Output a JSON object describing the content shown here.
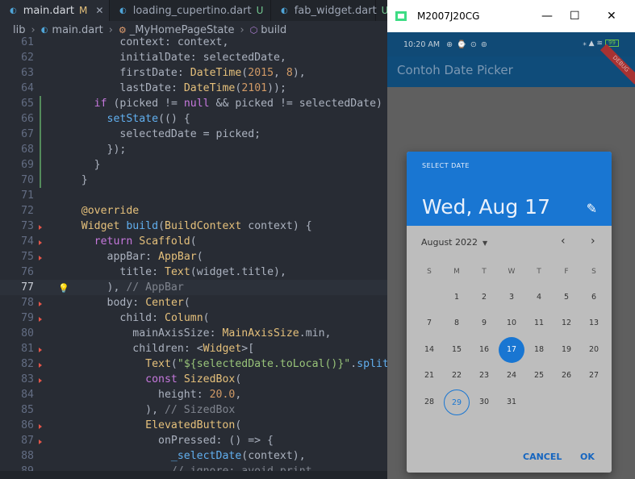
{
  "editor": {
    "tabs": [
      {
        "label": "main.dart",
        "mod": "M",
        "active": true
      },
      {
        "label": "loading_cupertino.dart",
        "mod": "U",
        "active": false
      },
      {
        "label": "fab_widget.dart",
        "mod": "U",
        "active": false
      }
    ],
    "breadcrumb": {
      "folder": "lib",
      "file": "main.dart",
      "cls": "_MyHomePageState",
      "method": "build"
    }
  },
  "code_lines": [
    {
      "n": "61",
      "t": "          context: context,"
    },
    {
      "n": "62",
      "t": "          initialDate: selectedDate,"
    },
    {
      "n": "63",
      "t": "          firstDate: DateTime(2015, 8),"
    },
    {
      "n": "64",
      "t": "          lastDate: DateTime(2101));"
    },
    {
      "n": "65",
      "t": "      if (picked != null && picked != selectedDate) {"
    },
    {
      "n": "66",
      "t": "        setState(() {"
    },
    {
      "n": "67",
      "t": "          selectedDate = picked;"
    },
    {
      "n": "68",
      "t": "        });"
    },
    {
      "n": "69",
      "t": "      }"
    },
    {
      "n": "70",
      "t": "    }"
    },
    {
      "n": "71",
      "t": ""
    },
    {
      "n": "72",
      "t": "    @override"
    },
    {
      "n": "73",
      "t": "    Widget build(BuildContext context) {"
    },
    {
      "n": "74",
      "t": "      return Scaffold("
    },
    {
      "n": "75",
      "t": "        appBar: AppBar("
    },
    {
      "n": "76",
      "t": "          title: Text(widget.title),"
    },
    {
      "n": "77",
      "t": "        ), // AppBar"
    },
    {
      "n": "78",
      "t": "        body: Center("
    },
    {
      "n": "79",
      "t": "          child: Column("
    },
    {
      "n": "80",
      "t": "            mainAxisSize: MainAxisSize.min,"
    },
    {
      "n": "81",
      "t": "            children: <Widget>["
    },
    {
      "n": "82",
      "t": "              Text(\"${selectedDate.toLocal()}\".split('"
    },
    {
      "n": "83",
      "t": "              const SizedBox("
    },
    {
      "n": "84",
      "t": "                height: 20.0,"
    },
    {
      "n": "85",
      "t": "              ), // SizedBox"
    },
    {
      "n": "86",
      "t": "              ElevatedButton("
    },
    {
      "n": "87",
      "t": "                onPressed: () => {"
    },
    {
      "n": "88",
      "t": "                  _selectDate(context),"
    },
    {
      "n": "89",
      "t": "                  // ignore: avoid_print"
    }
  ],
  "emulator": {
    "window_title": "M2007J20CG",
    "min": "—",
    "max": "☐",
    "close": "✕",
    "status_time": "10:20 AM",
    "status_icons": "⊕ ⌚ ⊙ ⊚",
    "status_right": "⁎ ▲ ≋",
    "battery": "99",
    "appbar_title": "Contoh Date Picker",
    "debug_banner": "DEBUG"
  },
  "dialog": {
    "caption": "SELECT DATE",
    "date": "Wed, Aug 17",
    "edit_icon": "✎",
    "month": "August 2022",
    "month_dropdown": "▼",
    "prev": "‹",
    "next": "›",
    "weekdays": [
      "S",
      "M",
      "T",
      "W",
      "T",
      "F",
      "S"
    ],
    "weeks": [
      [
        "",
        "1",
        "2",
        "3",
        "4",
        "5",
        "6"
      ],
      [
        "7",
        "8",
        "9",
        "10",
        "11",
        "12",
        "13"
      ],
      [
        "14",
        "15",
        "16",
        "17",
        "18",
        "19",
        "20"
      ],
      [
        "21",
        "22",
        "23",
        "24",
        "25",
        "26",
        "27"
      ],
      [
        "28",
        "29",
        "30",
        "31",
        "",
        "",
        ""
      ]
    ],
    "selected_day": "17",
    "today": "29",
    "cancel": "CANCEL",
    "ok": "OK"
  },
  "colors": {
    "accent": "#1976d2",
    "appbar": "#0f4c7a",
    "editor_bg": "#282c34"
  }
}
